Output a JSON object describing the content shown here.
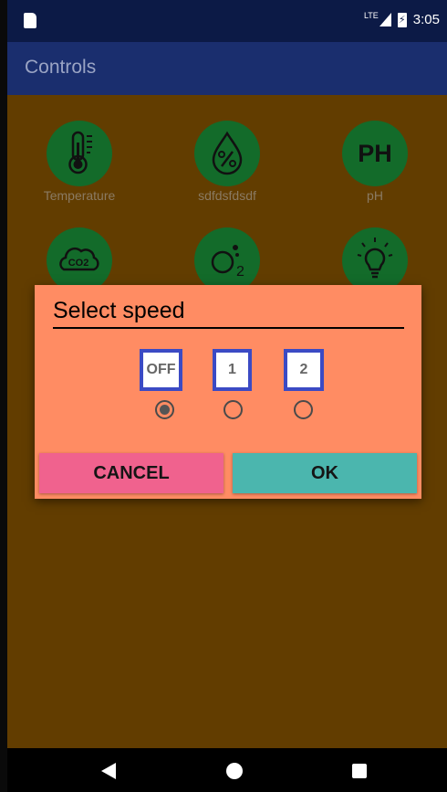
{
  "status_bar": {
    "network": "LTE",
    "time": "3:05"
  },
  "app_bar": {
    "title": "Controls"
  },
  "controls": [
    {
      "label": "Temperature",
      "icon": "thermometer-icon"
    },
    {
      "label": "sdfdsfdsdf",
      "icon": "humidity-drop-icon"
    },
    {
      "label": "pH",
      "icon": "ph-icon",
      "icon_text": "PH"
    },
    {
      "label": "",
      "icon": "co2-cloud-icon",
      "icon_text": "CO2"
    },
    {
      "label": "",
      "icon": "oxygen-icon",
      "icon_text": "2"
    },
    {
      "label": "",
      "icon": "lightbulb-icon"
    }
  ],
  "dialog": {
    "title": "Select speed",
    "options": [
      {
        "label": "OFF",
        "selected": true
      },
      {
        "label": "1",
        "selected": false
      },
      {
        "label": "2",
        "selected": false
      }
    ],
    "cancel_label": "CANCEL",
    "ok_label": "OK"
  },
  "colors": {
    "app_bar": "#1a2e6e",
    "content_background": "#623d00",
    "tile": "#136b2a",
    "dialog": "#ff8c63",
    "cancel_button": "#f0628e",
    "ok_button": "#4bb6ae",
    "option_border": "#3b4ac4"
  }
}
